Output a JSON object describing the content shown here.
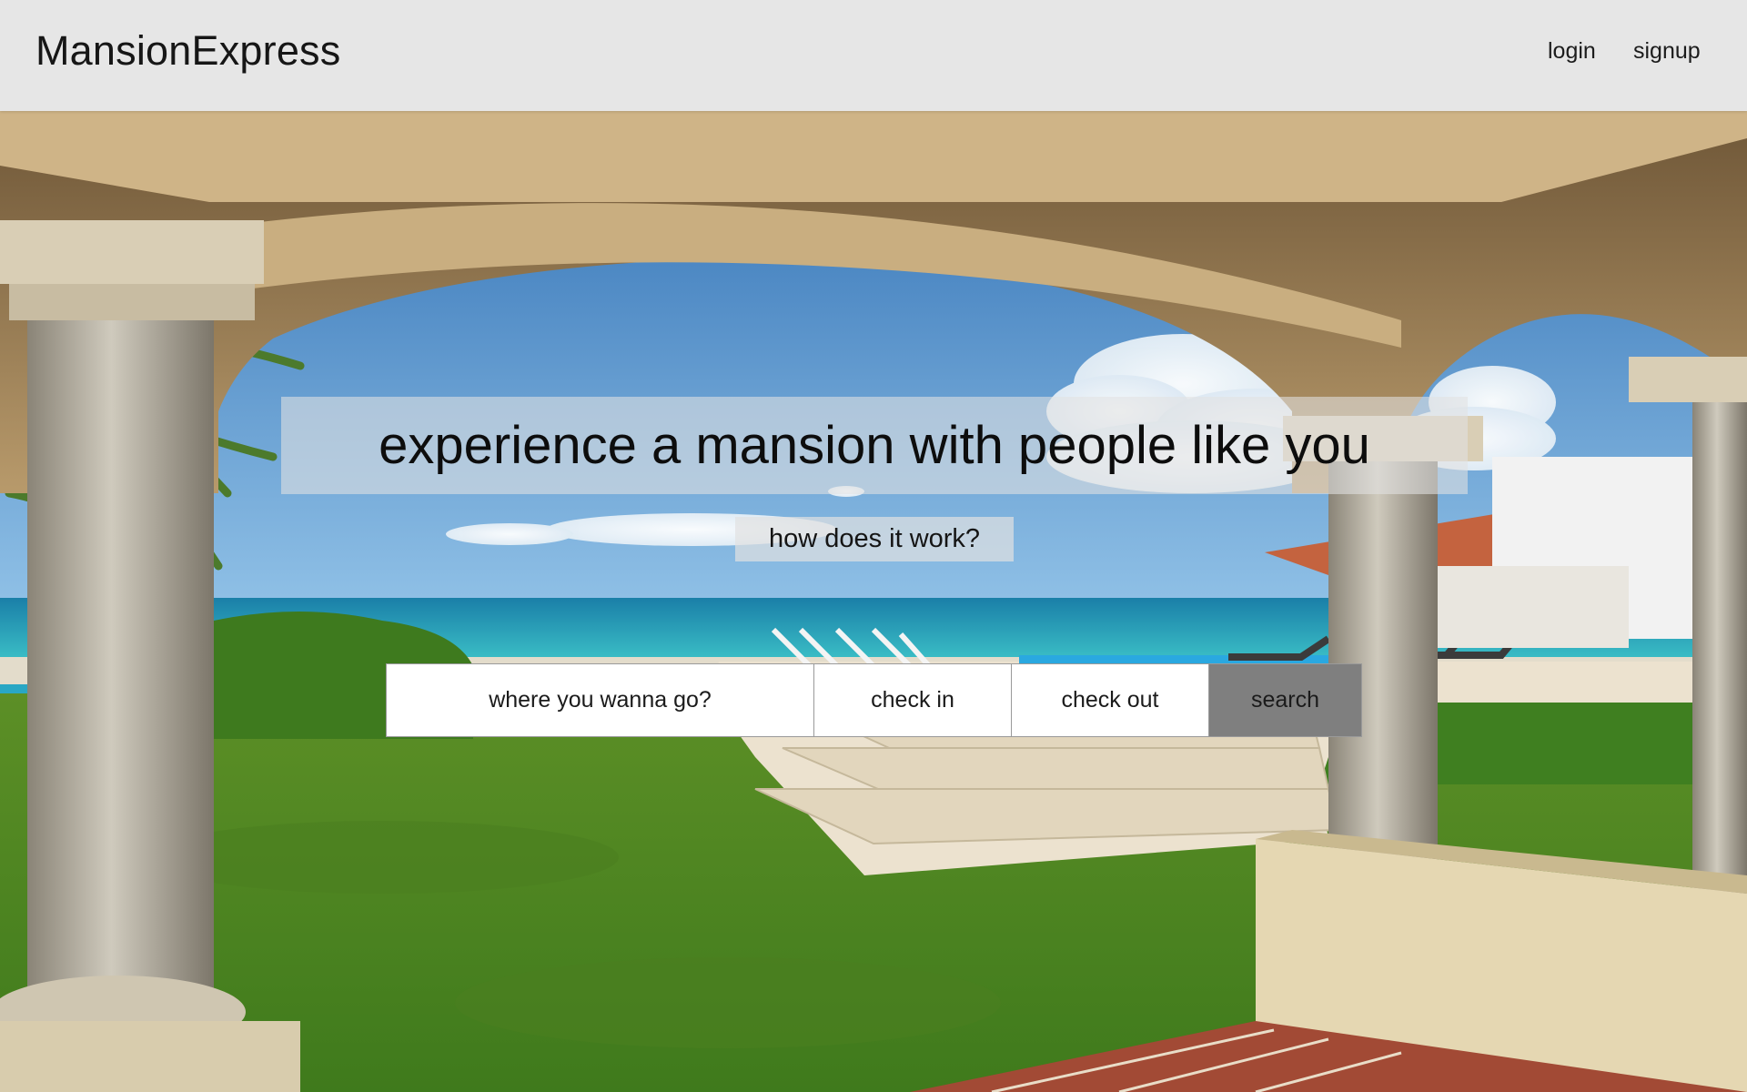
{
  "header": {
    "brand": "MansionExpress",
    "nav": {
      "login": "login",
      "signup": "signup"
    }
  },
  "hero": {
    "headline": "experience a mansion with people like you",
    "how_button": "how does it work?",
    "search": {
      "where_placeholder": "where you wanna go?",
      "check_in_placeholder": "check in",
      "check_out_placeholder": "check out",
      "search_label": "search"
    }
  },
  "colors": {
    "topbar_bg": "#e6e6e6",
    "search_button_bg": "#7f7f7f",
    "text": "#161616"
  }
}
